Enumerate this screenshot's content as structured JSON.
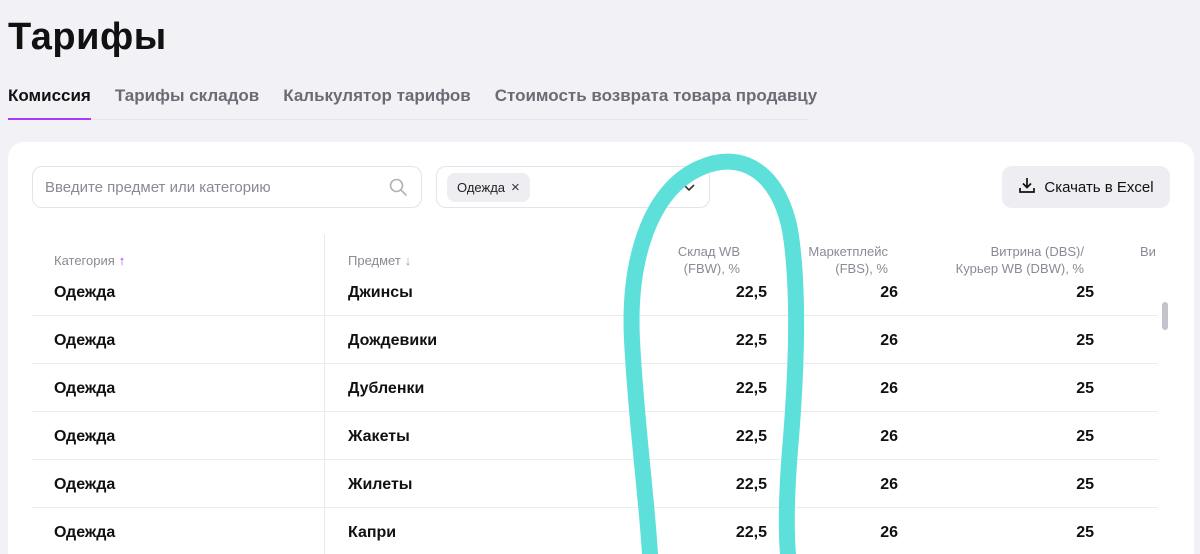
{
  "page": {
    "title": "Тарифы"
  },
  "tabs": [
    {
      "label": "Комиссия",
      "active": true
    },
    {
      "label": "Тарифы складов",
      "active": false
    },
    {
      "label": "Калькулятор тарифов",
      "active": false
    },
    {
      "label": "Стоимость возврата товара продавцу",
      "active": false
    }
  ],
  "search": {
    "placeholder": "Введите предмет или категорию",
    "value": ""
  },
  "filter": {
    "chip_label": "Одежда"
  },
  "excel_button": {
    "label": "Скачать в Excel"
  },
  "table": {
    "headers": {
      "category": "Категория",
      "subject": "Предмет",
      "fbw_line1": "Склад WB",
      "fbw_line2": "(FBW), %",
      "fbs_line1": "Маркетплейс",
      "fbs_line2": "(FBS), %",
      "dbs_line1": "Витрина (DBS)/",
      "dbs_line2": "Курьер WB (DBW), %",
      "cut": "Ви"
    },
    "rows": [
      {
        "category": "Одежда",
        "subject": "Джинсы",
        "fbw": "22,5",
        "fbs": "26",
        "dbs": "25"
      },
      {
        "category": "Одежда",
        "subject": "Дождевики",
        "fbw": "22,5",
        "fbs": "26",
        "dbs": "25"
      },
      {
        "category": "Одежда",
        "subject": "Дубленки",
        "fbw": "22,5",
        "fbs": "26",
        "dbs": "25"
      },
      {
        "category": "Одежда",
        "subject": "Жакеты",
        "fbw": "22,5",
        "fbs": "26",
        "dbs": "25"
      },
      {
        "category": "Одежда",
        "subject": "Жилеты",
        "fbw": "22,5",
        "fbs": "26",
        "dbs": "25"
      },
      {
        "category": "Одежда",
        "subject": "Капри",
        "fbw": "22,5",
        "fbs": "26",
        "dbs": "25"
      }
    ]
  },
  "colors": {
    "accent": "#a73afd",
    "annotation": "#5ee0da"
  }
}
